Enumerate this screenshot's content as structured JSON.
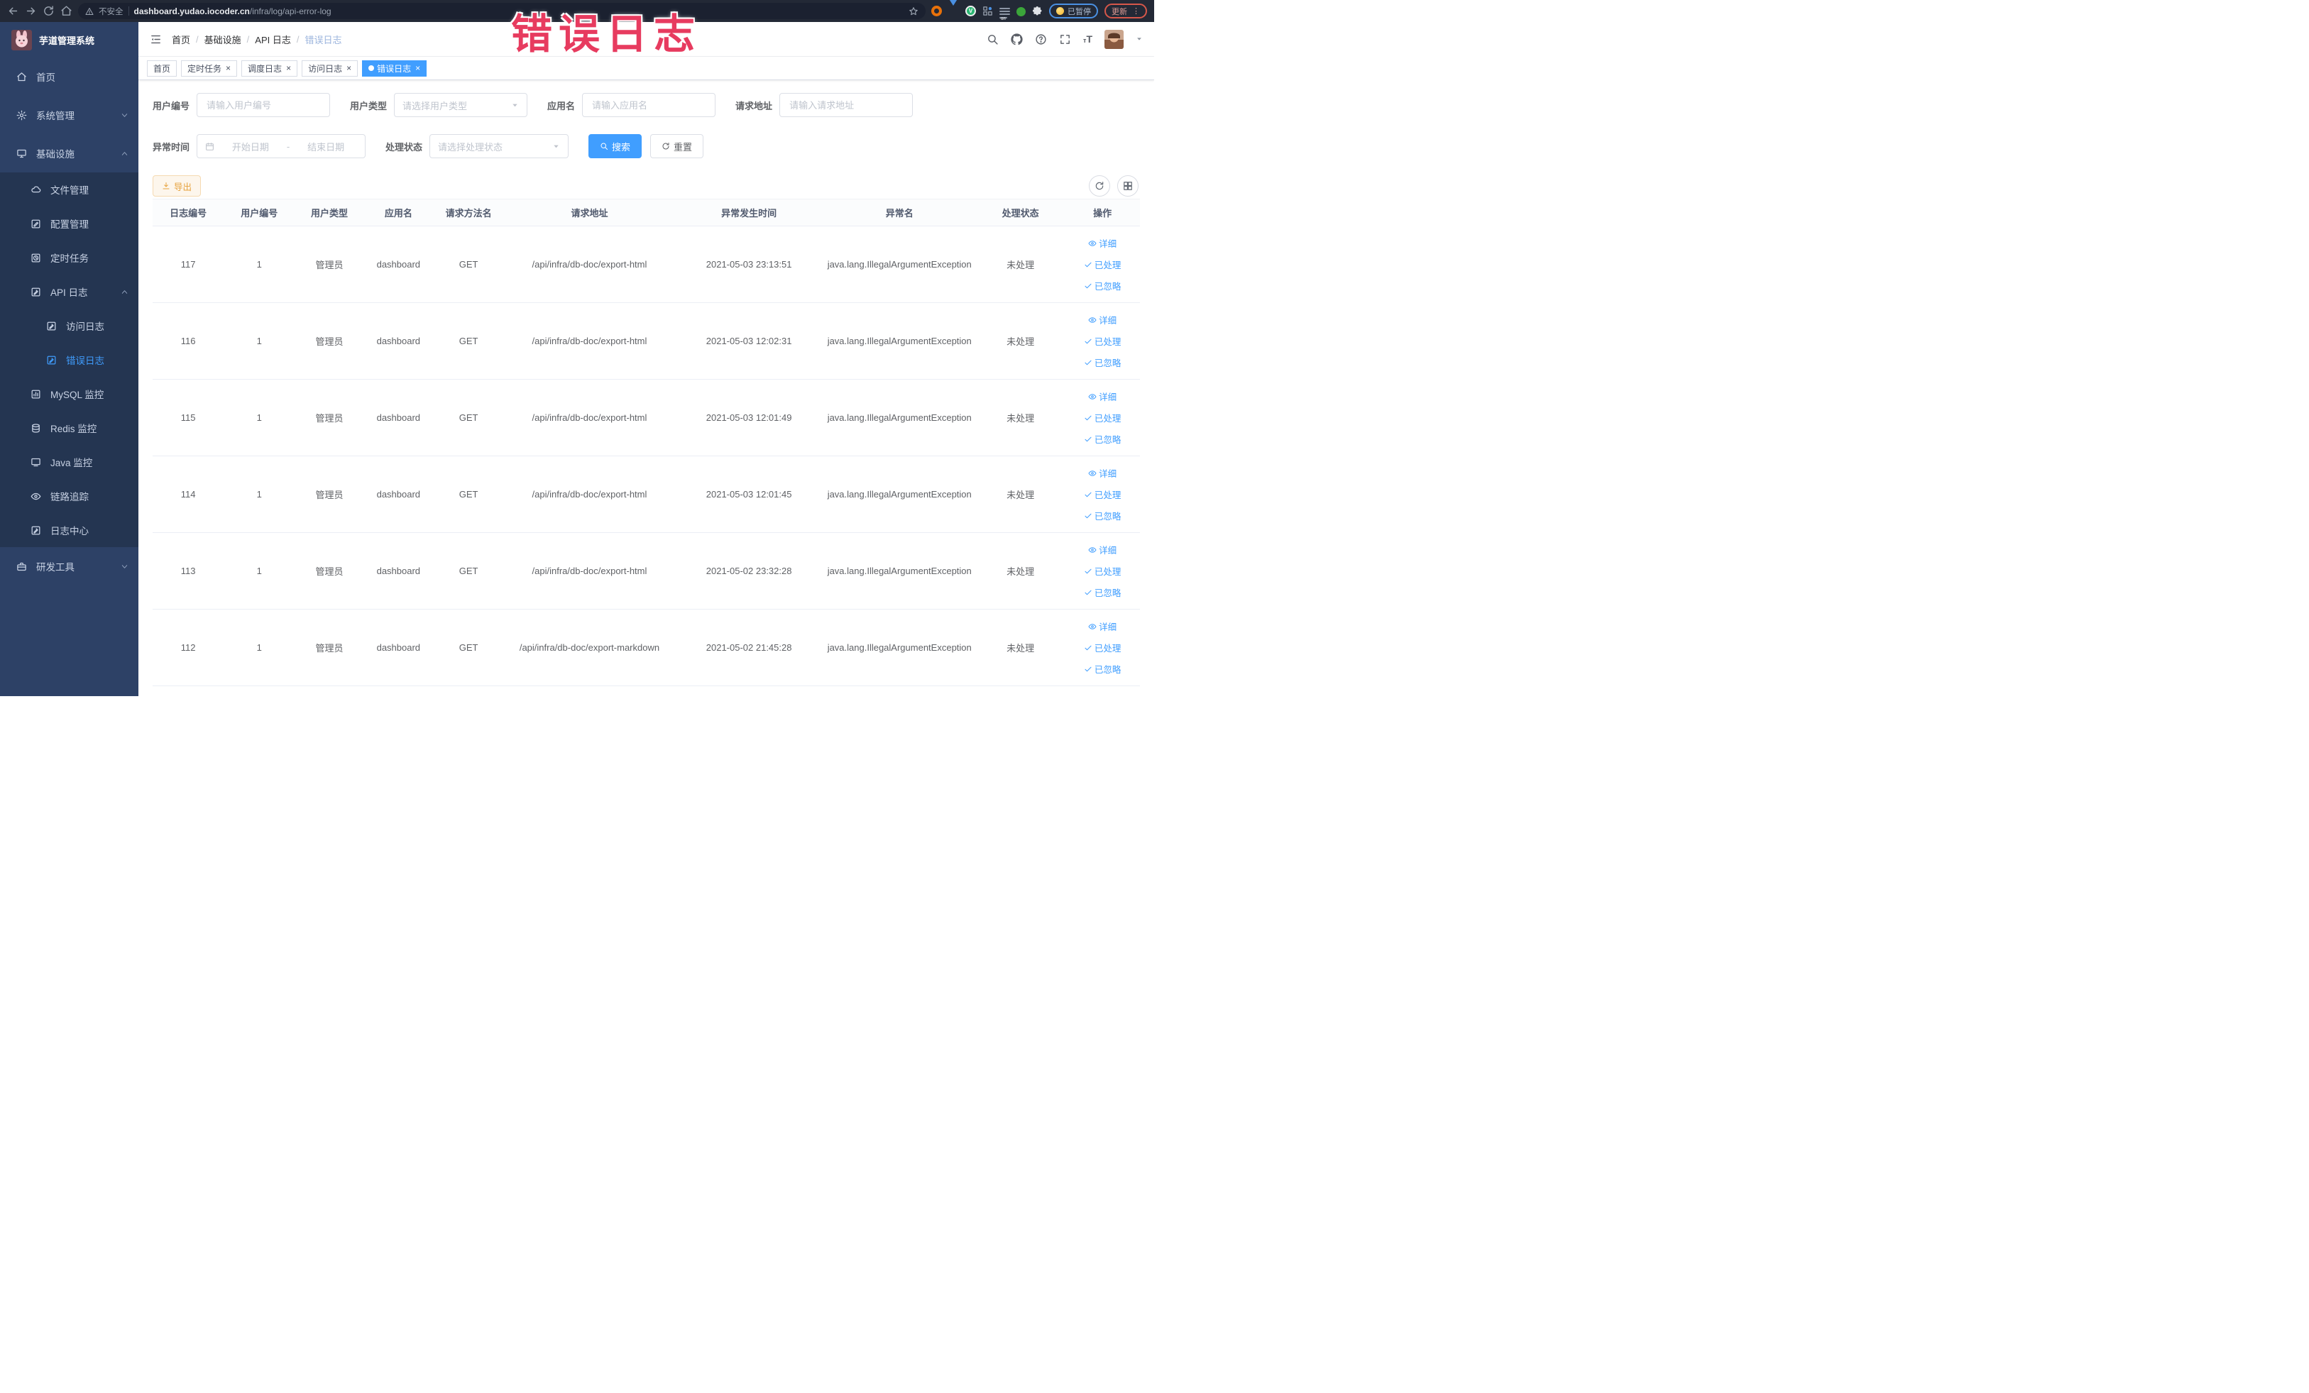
{
  "overlay": {
    "title": "错误日志"
  },
  "browser": {
    "security_text": "不安全",
    "url_host": "dashboard.yudao.iocoder.cn",
    "url_path": "/infra/log/api-error-log",
    "paused_label": "已暂停",
    "update_label": "更新"
  },
  "sidebar": {
    "app_title": "芋道管理系统",
    "items": [
      {
        "label": "首页",
        "icon": "home-icon",
        "level": 1
      },
      {
        "label": "系统管理",
        "icon": "gear-icon",
        "level": 1,
        "chevron": "down"
      },
      {
        "label": "基础设施",
        "icon": "monitor-icon",
        "level": 1,
        "chevron": "up"
      },
      {
        "label": "文件管理",
        "icon": "cloud-icon",
        "level": 2
      },
      {
        "label": "配置管理",
        "icon": "edit-icon",
        "level": 2
      },
      {
        "label": "定时任务",
        "icon": "timer-icon",
        "level": 2
      },
      {
        "label": "API 日志",
        "icon": "log-icon",
        "level": 2,
        "chevron": "up"
      },
      {
        "label": "访问日志",
        "icon": "log-icon",
        "level": 3
      },
      {
        "label": "错误日志",
        "icon": "log-icon",
        "level": 3,
        "active": true
      },
      {
        "label": "MySQL 监控",
        "icon": "chart-icon",
        "level": 2
      },
      {
        "label": "Redis 监控",
        "icon": "database-icon",
        "level": 2
      },
      {
        "label": "Java 监控",
        "icon": "screen-icon",
        "level": 2
      },
      {
        "label": "链路追踪",
        "icon": "eye-icon",
        "level": 2
      },
      {
        "label": "日志中心",
        "icon": "log-icon",
        "level": 2
      },
      {
        "label": "研发工具",
        "icon": "toolbox-icon",
        "level": 1,
        "chevron": "down"
      }
    ]
  },
  "header": {
    "breadcrumb": [
      "首页",
      "基础设施",
      "API 日志",
      "错误日志"
    ],
    "separator": "/"
  },
  "tags": [
    {
      "label": "首页"
    },
    {
      "label": "定时任务",
      "closable": true
    },
    {
      "label": "调度日志",
      "closable": true
    },
    {
      "label": "访问日志",
      "closable": true
    },
    {
      "label": "错误日志",
      "closable": true,
      "active": true
    }
  ],
  "filters": {
    "user_id_label": "用户编号",
    "user_id_placeholder": "请输入用户编号",
    "user_type_label": "用户类型",
    "user_type_placeholder": "请选择用户类型",
    "app_name_label": "应用名",
    "app_name_placeholder": "请输入应用名",
    "request_url_label": "请求地址",
    "request_url_placeholder": "请输入请求地址",
    "exception_time_label": "异常时间",
    "date_start_placeholder": "开始日期",
    "date_separator": "-",
    "date_end_placeholder": "结束日期",
    "process_status_label": "处理状态",
    "process_status_placeholder": "请选择处理状态",
    "search_label": "搜索",
    "reset_label": "重置"
  },
  "toolbar": {
    "export_label": "导出"
  },
  "table": {
    "columns": [
      "日志编号",
      "用户编号",
      "用户类型",
      "应用名",
      "请求方法名",
      "请求地址",
      "异常发生时间",
      "异常名",
      "处理状态",
      "操作"
    ],
    "action_labels": [
      "详细",
      "已处理",
      "已忽略"
    ],
    "rows": [
      {
        "id": "117",
        "user_id": "1",
        "user_type": "管理员",
        "app": "dashboard",
        "method": "GET",
        "url": "/api/infra/db-doc/export-html",
        "time": "2021-05-03 23:13:51",
        "exception": "java.lang.IllegalArgumentException",
        "status": "未处理"
      },
      {
        "id": "116",
        "user_id": "1",
        "user_type": "管理员",
        "app": "dashboard",
        "method": "GET",
        "url": "/api/infra/db-doc/export-html",
        "time": "2021-05-03 12:02:31",
        "exception": "java.lang.IllegalArgumentException",
        "status": "未处理"
      },
      {
        "id": "115",
        "user_id": "1",
        "user_type": "管理员",
        "app": "dashboard",
        "method": "GET",
        "url": "/api/infra/db-doc/export-html",
        "time": "2021-05-03 12:01:49",
        "exception": "java.lang.IllegalArgumentException",
        "status": "未处理"
      },
      {
        "id": "114",
        "user_id": "1",
        "user_type": "管理员",
        "app": "dashboard",
        "method": "GET",
        "url": "/api/infra/db-doc/export-html",
        "time": "2021-05-03 12:01:45",
        "exception": "java.lang.IllegalArgumentException",
        "status": "未处理"
      },
      {
        "id": "113",
        "user_id": "1",
        "user_type": "管理员",
        "app": "dashboard",
        "method": "GET",
        "url": "/api/infra/db-doc/export-html",
        "time": "2021-05-02 23:32:28",
        "exception": "java.lang.IllegalArgumentException",
        "status": "未处理"
      },
      {
        "id": "112",
        "user_id": "1",
        "user_type": "管理员",
        "app": "dashboard",
        "method": "GET",
        "url": "/api/infra/db-doc/export-markdown",
        "time": "2021-05-02 21:45:28",
        "exception": "java.lang.IllegalArgumentException",
        "status": "未处理"
      }
    ]
  },
  "colors": {
    "accent": "#409eff",
    "sidebar_bg": "#2d4166",
    "sidebar_sub_bg": "#243551",
    "warning": "#e6a23c",
    "overlay_red": "#e73b5f",
    "active_tag": "#409eff"
  }
}
